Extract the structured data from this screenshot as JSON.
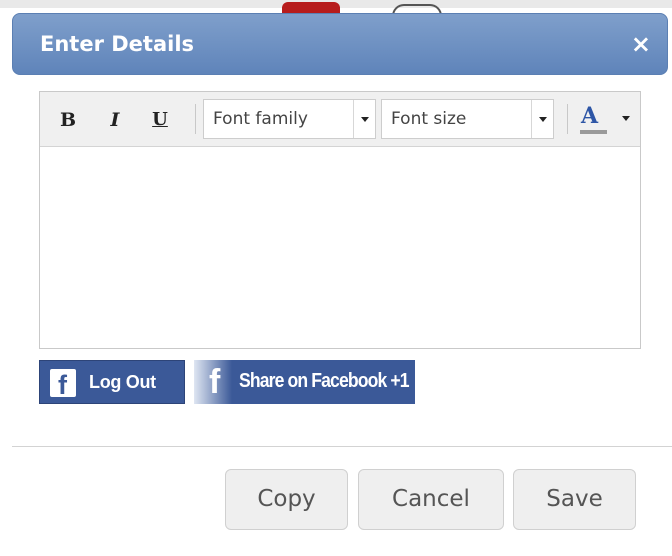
{
  "dialog": {
    "title": "Enter Details",
    "close_glyph": "×"
  },
  "toolbar": {
    "bold_label": "B",
    "italic_label": "I",
    "underline_label": "U",
    "font_family_placeholder": "Font family",
    "font_size_placeholder": "Font size",
    "text_color_label": "A"
  },
  "editor": {
    "content": ""
  },
  "facebook": {
    "logout_label": "Log Out",
    "logout_logo": "f",
    "share_label": "Share on Facebook +1",
    "share_logo": "f",
    "brand_color": "#3b5998"
  },
  "footer": {
    "copy_label": "Copy",
    "cancel_label": "Cancel",
    "save_label": "Save"
  },
  "colors": {
    "header_blue": "#6a8dc1",
    "text_color_swatch": "#9a9a9a"
  }
}
